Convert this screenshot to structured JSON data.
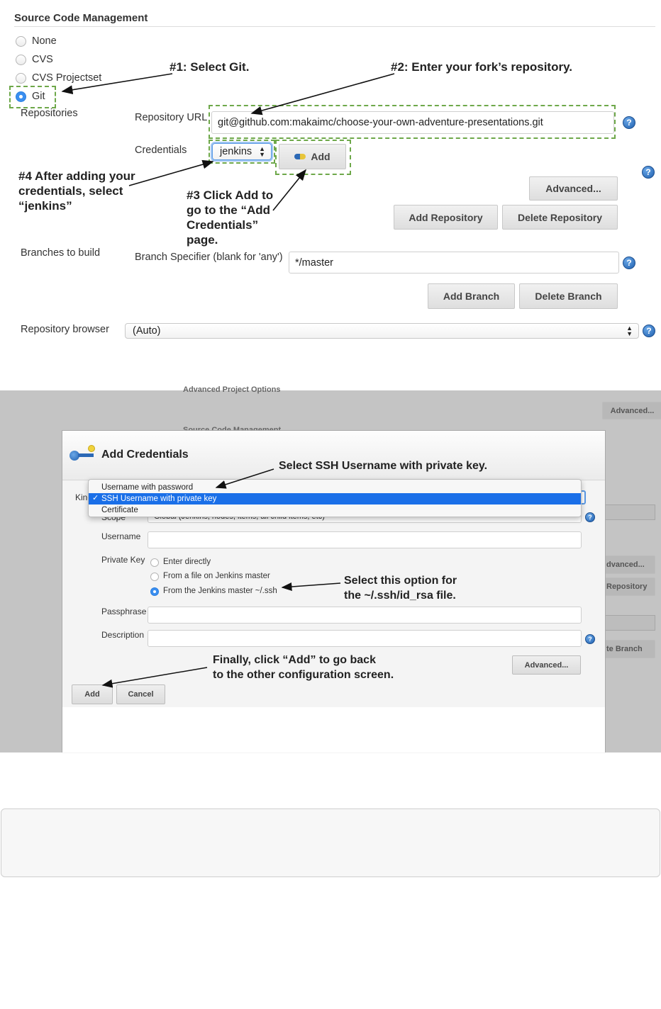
{
  "scm": {
    "title": "Source Code Management",
    "options": [
      "None",
      "CVS",
      "CVS Projectset",
      "Git"
    ],
    "selected": "Git",
    "repositories_label": "Repositories",
    "repo_url_label": "Repository URL",
    "repo_url_value": "git@github.com:makaimc/choose-your-own-adventure-presentations.git",
    "credentials_label": "Credentials",
    "credentials_value": "jenkins",
    "add_label": "Add",
    "advanced_label": "Advanced...",
    "add_repository_label": "Add Repository",
    "delete_repository_label": "Delete Repository",
    "branches_label": "Branches to build",
    "branch_specifier_label": "Branch Specifier (blank for 'any')",
    "branch_specifier_value": "*/master",
    "add_branch_label": "Add Branch",
    "delete_branch_label": "Delete Branch",
    "repo_browser_label": "Repository browser",
    "repo_browser_value": "(Auto)"
  },
  "annotations": {
    "a1": "#1: Select Git.",
    "a2": "#2: Enter your fork’s repository.",
    "a3": [
      "#3 Click Add to",
      "go to the “Add",
      "Credentials”",
      "page."
    ],
    "a4": [
      "#4 After adding your",
      "credentials, select",
      "“jenkins”"
    ],
    "m1": "Select SSH Username with private key.",
    "m2": [
      "Select this option for",
      "the ~/.ssh/id_rsa file."
    ],
    "m3": [
      "Finally, click “Add” to go back",
      "to the other configuration screen."
    ]
  },
  "background": {
    "section1": "Advanced Project Options",
    "section2": "Source Code Management",
    "advanced_label": "Advanced...",
    "frag_advanced": "dvanced...",
    "frag_repository": "Repository",
    "frag_branch": "te Branch"
  },
  "dialog": {
    "title": "Add Credentials",
    "kind_label": "Kind",
    "kind_options": [
      "Username with password",
      "SSH Username with private key",
      "Certificate"
    ],
    "kind_selected": "SSH Username with private key",
    "scope_label": "Scope",
    "scope_value": "Global (Jenkins, nodes, items, all child items, etc)",
    "username_label": "Username",
    "private_key_label": "Private Key",
    "pk_options": [
      "Enter directly",
      "From a file on Jenkins master",
      "From the Jenkins master ~/.ssh"
    ],
    "pk_selected": "From the Jenkins master ~/.ssh",
    "passphrase_label": "Passphrase",
    "description_label": "Description",
    "advanced_label": "Advanced...",
    "add_label": "Add",
    "cancel_label": "Cancel"
  },
  "colors": {
    "dashed_highlight": "#6ea84a",
    "selection_blue": "#1a6fe8",
    "radio_blue": "#3b8ff0"
  }
}
